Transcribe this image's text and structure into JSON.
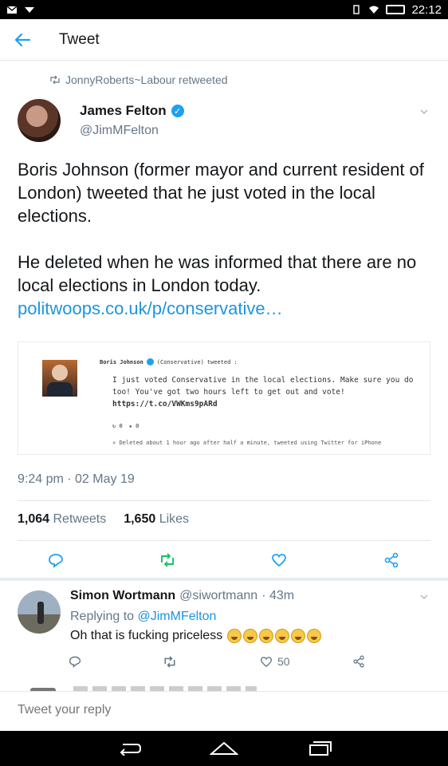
{
  "status_bar": {
    "time": "22:12"
  },
  "app_bar": {
    "title": "Tweet"
  },
  "tweet": {
    "retweeted_by": "JonnyRoberts~Labour retweeted",
    "author_name": "James Felton",
    "author_handle": "@JimMFelton",
    "paragraph_1": "Boris Johnson (former mayor and current resident of London) tweeted that he just voted in the local elections.",
    "paragraph_2": "He deleted when he was informed that there are no local elections in London today.",
    "link": "politwoops.co.uk/p/conservative…",
    "timestamp": "9:24 pm · 02 May 19",
    "retweet_count": "1,064",
    "retweet_label": "Retweets",
    "like_count": "1,650",
    "like_label": "Likes"
  },
  "embedded_card": {
    "author": "Boris Johnson",
    "party": "(Conservative)",
    "verb": "tweeted :",
    "text": "I just voted Conservative in the local elections. Make sure you do too! You've got two hours left to get out and vote!",
    "url": "https://t.co/VWKms9pARd",
    "retweets": "0",
    "likes": "0",
    "footer": "Deleted about 1 hour ago after half a minute, tweeted using Twitter for iPhone"
  },
  "reply": {
    "author_name": "Simon Wortmann",
    "author_handle": "@siwortmann",
    "age": "· 43m",
    "replying_prefix": "Replying to",
    "replying_to": "@JimMFelton",
    "text": "Oh that is fucking priceless",
    "like_count": "50"
  },
  "composer": {
    "placeholder": "Tweet your reply"
  },
  "icons": {
    "back": "back-arrow-icon",
    "retweet": "retweet-icon",
    "reply": "reply-icon",
    "like": "heart-icon",
    "share": "share-icon",
    "emoji": "laughing-emoji-icon"
  },
  "colors": {
    "accent": "#1da1f2",
    "retweet_green": "#17bf63",
    "muted": "#657786"
  }
}
